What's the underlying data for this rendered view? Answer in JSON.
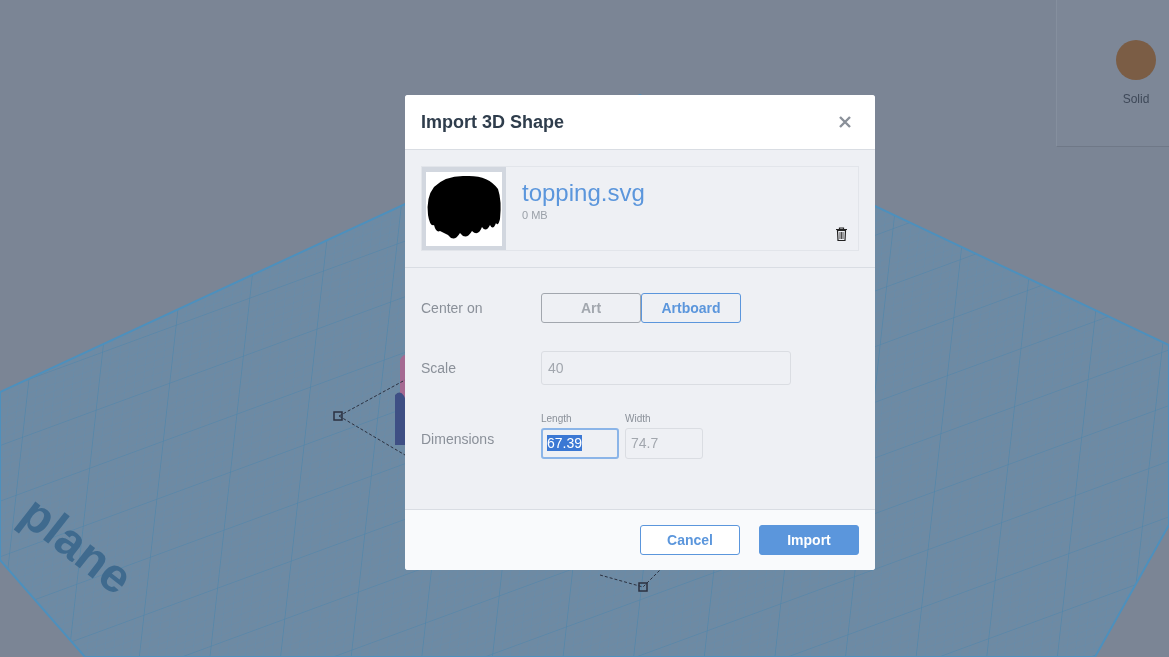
{
  "workplane": {
    "label": "plane"
  },
  "side_panel": {
    "swatches": [
      {
        "label": "Solid",
        "color": "#7b5d45"
      }
    ]
  },
  "dialog": {
    "title": "Import 3D Shape",
    "file": {
      "name": "topping.svg",
      "size": "0 MB"
    },
    "center_on": {
      "label": "Center on",
      "options": [
        {
          "label": "Art",
          "selected": false
        },
        {
          "label": "Artboard",
          "selected": true
        }
      ]
    },
    "scale": {
      "label": "Scale",
      "value": "40"
    },
    "dimensions": {
      "label": "Dimensions",
      "fields": [
        {
          "label": "Length",
          "value": "67.39",
          "selected": true
        },
        {
          "label": "Width",
          "value": "74.7",
          "selected": false
        }
      ]
    },
    "buttons": [
      {
        "label": "Cancel",
        "kind": "secondary"
      },
      {
        "label": "Import",
        "kind": "primary"
      }
    ]
  }
}
